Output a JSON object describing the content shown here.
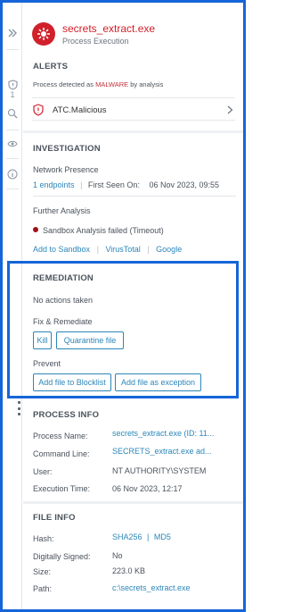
{
  "header": {
    "title": "secrets_extract.exe",
    "subtitle": "Process Execution"
  },
  "rail": {
    "shield_badge": "1"
  },
  "alerts": {
    "heading": "ALERTS",
    "detected_prefix": "Process detected as",
    "detected_malware": "MALWARE",
    "detected_suffix": "by analysis",
    "alert_name": "ATC.Malicious"
  },
  "investigation": {
    "heading": "INVESTIGATION",
    "network_label": "Network Presence",
    "endpoints": "1 endpoints",
    "sep": "|",
    "first_seen_label": "First Seen On:",
    "first_seen_value": "06 Nov 2023, 09:55",
    "further_label": "Further Analysis",
    "sandbox_status": "Sandbox Analysis failed (Timeout)",
    "links": [
      "Add to Sandbox",
      "VirusTotal",
      "Google"
    ]
  },
  "remediation": {
    "heading": "REMEDIATION",
    "status": "No actions taken",
    "fix_label": "Fix & Remediate",
    "kill_label": "Kill",
    "quarantine_label": "Quarantine file",
    "prevent_label": "Prevent",
    "blocklist_label": "Add file to Blocklist",
    "exception_label": "Add file as exception"
  },
  "process_info": {
    "heading": "PROCESS INFO",
    "rows": [
      {
        "label": "Process Name:",
        "value": "secrets_extract.exe (ID: 11..."
      },
      {
        "label": "Command Line:",
        "value": "SECRETS_extract.exe ad..."
      },
      {
        "label": "User:",
        "value": "NT AUTHORITY\\SYSTEM"
      },
      {
        "label": "Execution Time:",
        "value": "06 Nov 2023, 12:17"
      }
    ]
  },
  "file_info": {
    "heading": "FILE INFO",
    "hash_label": "Hash:",
    "hash_sha": "SHA256",
    "hash_sep": "|",
    "hash_md5": "MD5",
    "signed_label": "Digitally Signed:",
    "signed_value": "No",
    "size_label": "Size:",
    "size_value": "223.0 KB",
    "path_label": "Path:",
    "path_value": "c:\\secrets_extract.exe"
  },
  "colors": {
    "accent_blue": "#1565d8",
    "link": "#2b86b8",
    "danger": "#d0202a"
  }
}
